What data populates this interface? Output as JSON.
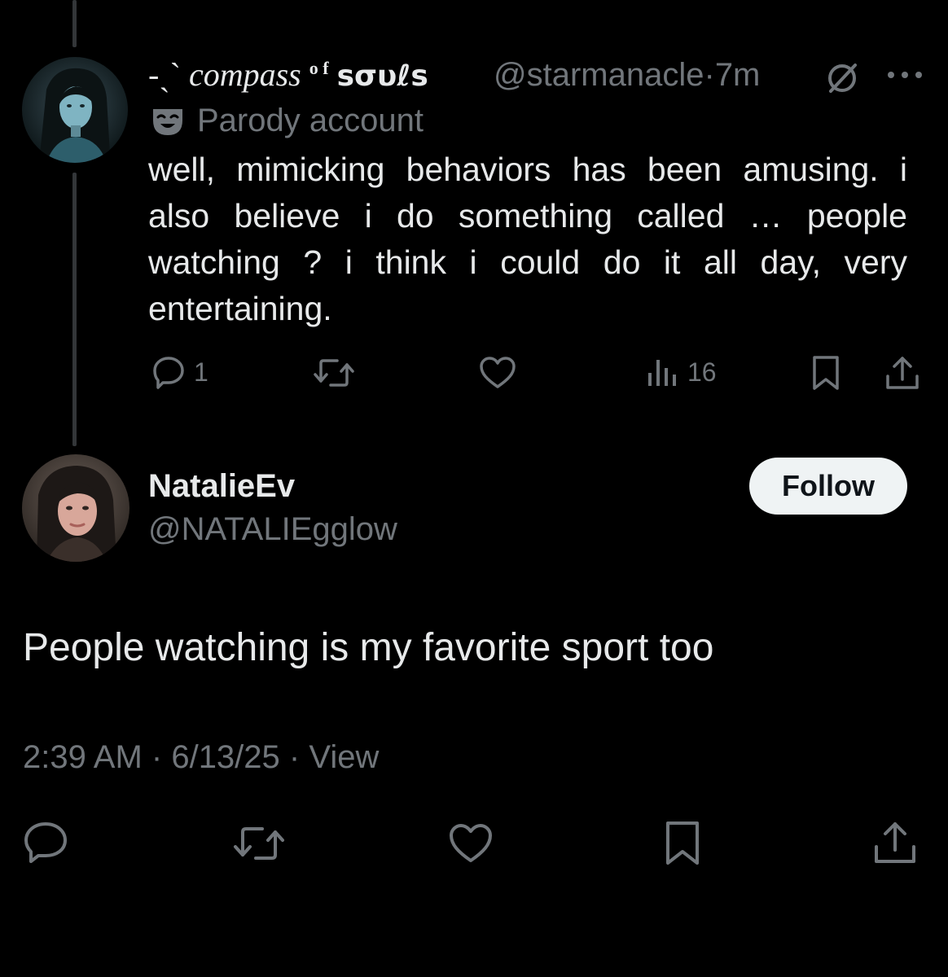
{
  "parent_tweet": {
    "display_name_prefix": "-ˏˋ",
    "display_name_main": "compass",
    "display_name_sup": "o f",
    "display_name_souls": "sσυℓs",
    "handle": "@starmanacle",
    "separator": "·",
    "time": "7m",
    "parody_label": "Parody account",
    "text": "well, mimicking behaviors has been amusing. i also believe i do something called … people watching ? i think i could do it all day, very entertaining.",
    "actions": {
      "reply_count": "1",
      "retweet_count": "",
      "like_count": "",
      "views_count": "16"
    }
  },
  "reply_tweet": {
    "display_name": "NatalieEv",
    "handle": "@NATALIEgglow",
    "follow_label": "Follow",
    "text": "People watching is my favorite sport too",
    "time": "2:39 AM",
    "date": "6/13/25",
    "view_label": "View"
  },
  "icons": {
    "reply": "reply-icon",
    "retweet": "retweet-icon",
    "like": "heart-icon",
    "views": "views-icon",
    "bookmark": "bookmark-icon",
    "share": "share-icon",
    "muted": "muted-icon",
    "more": "more-icon",
    "parody": "parody-mask-icon"
  },
  "colors": {
    "background": "#000000",
    "text_primary": "#e7e9ea",
    "text_secondary": "#71767b",
    "thread_line": "#333639",
    "follow_button_bg": "#eff3f4"
  }
}
